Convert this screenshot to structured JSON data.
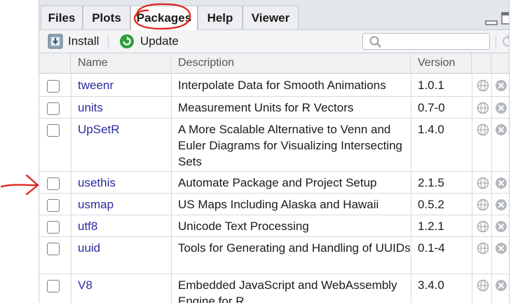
{
  "tabs": [
    {
      "label": "Files"
    },
    {
      "label": "Plots"
    },
    {
      "label": "Packages"
    },
    {
      "label": "Help"
    },
    {
      "label": "Viewer"
    }
  ],
  "toolbar": {
    "install_label": "Install",
    "update_label": "Update",
    "search_placeholder": ""
  },
  "columns": {
    "name": "Name",
    "description": "Description",
    "version": "Version"
  },
  "packages": [
    {
      "name": "tweenr",
      "description": "Interpolate Data for Smooth Animations",
      "version": "1.0.1"
    },
    {
      "name": "units",
      "description": "Measurement Units for R Vectors",
      "version": "0.7-0"
    },
    {
      "name": "UpSetR",
      "description": "A More Scalable Alternative to Venn and Euler Diagrams for Visualizing Intersecting Sets",
      "version": "1.4.0"
    },
    {
      "name": "usethis",
      "description": "Automate Package and Project Setup",
      "version": "2.1.5"
    },
    {
      "name": "usmap",
      "description": "US Maps Including Alaska and Hawaii",
      "version": "0.5.2"
    },
    {
      "name": "utf8",
      "description": "Unicode Text Processing",
      "version": "1.2.1"
    },
    {
      "name": "uuid",
      "description": "Tools for Generating and Handling of UUIDs",
      "version": "0.1-4"
    },
    {
      "name": "V8",
      "description": "Embedded JavaScript and WebAssembly Engine for R",
      "version": "3.4.0"
    }
  ],
  "colors": {
    "link": "#2b2ba0",
    "annotation": "#e0201a",
    "update_green": "#2e9e3e"
  }
}
